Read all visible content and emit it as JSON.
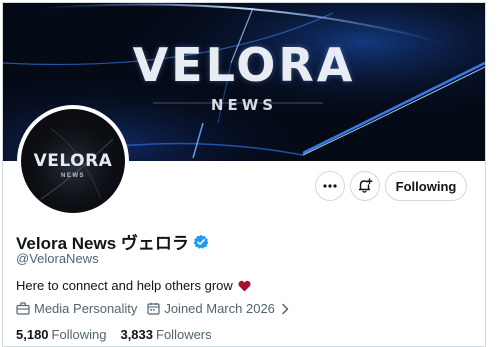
{
  "banner": {
    "title": "VELORA",
    "subtitle": "NEWS",
    "background": "#050a17",
    "glow": "#2f7bff"
  },
  "avatar": {
    "title": "VELORA",
    "subtitle": "NEWS"
  },
  "actions": {
    "more_icon": "more-horizontal-icon",
    "notify_icon": "bell-plus-icon",
    "following_label": "Following"
  },
  "profile": {
    "display_name": "Velora News ヴェロラ",
    "verified": true,
    "verified_color": "#1d9bf0",
    "handle": "@VeloraNews",
    "bio": "Here to connect and help others grow",
    "bio_emoji": "heart",
    "heart_color": "#a3122a",
    "category": "Media Personality",
    "joined": "Joined March 2026"
  },
  "stats": {
    "following_count": "5,180",
    "following_label": "Following",
    "followers_count": "3,833",
    "followers_label": "Followers"
  }
}
